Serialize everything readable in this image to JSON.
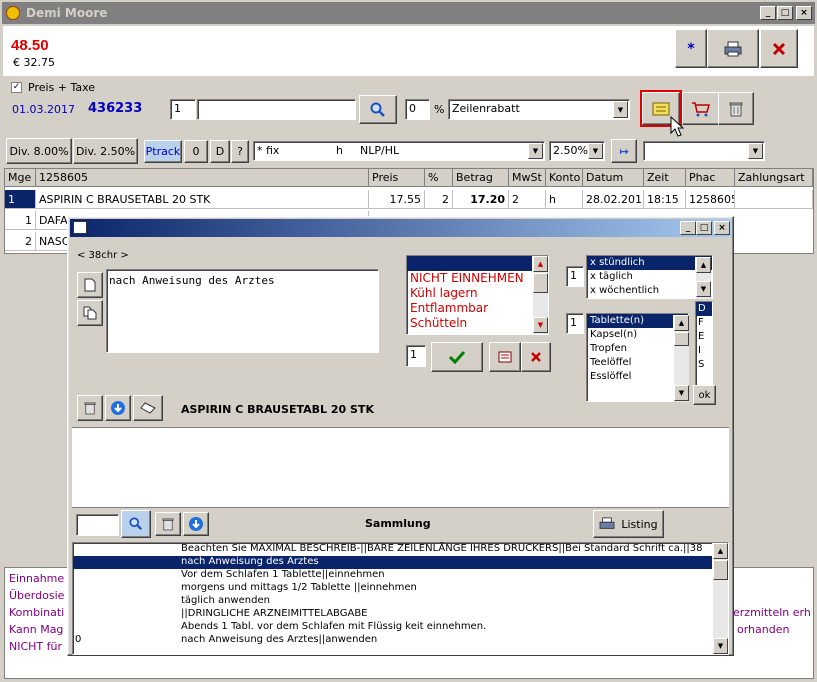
{
  "window": {
    "title": "Demi Moore"
  },
  "header": {
    "price_main": "48.50",
    "price_sub": "€ 32.75",
    "star_label": "*"
  },
  "toolbar": {
    "checkbox_label": "Preis + Taxe",
    "date": "01.03.2017",
    "number": "436233",
    "qty_value": "1",
    "article_value": "",
    "percent_value": "0",
    "percent_sign": "%",
    "discount_select": "Zeilenrabatt"
  },
  "row2": {
    "div1": "Div. 8.00%",
    "div2": "Div. 2.50%",
    "ptrack": "Ptrack",
    "zero": "0",
    "d": "D",
    "q": "?",
    "fix_select": "* fix",
    "fix_h": "h",
    "fix_nlp": "NLP/HL",
    "vat_select": "2.50%",
    "right_select": ""
  },
  "table": {
    "headers": [
      "Mge",
      "1258605",
      "Preis",
      "%",
      "Betrag",
      "MwSt",
      "Konto",
      "Datum",
      "Zeit",
      "Phac",
      "Zahlungsart"
    ],
    "rows": [
      [
        "1",
        "ASPIRIN C BRAUSETABL 20 STK",
        "17.55",
        "2",
        "17.20",
        "2",
        "h",
        "28.02.2017",
        "18:15",
        "1258605",
        ""
      ],
      [
        "1",
        "DAFA",
        "",
        "",
        "",
        "",
        "",
        "",
        "",
        "",
        ""
      ],
      [
        "2",
        "NASC",
        "",
        "",
        "",
        "",
        "",
        "",
        "",
        "",
        ""
      ]
    ]
  },
  "info_lines": [
    "Einnahme",
    "Überdosie",
    "Kombinati",
    "Kann Mag",
    "NICHT für"
  ],
  "info_right": [
    "erzmitteln erh",
    "orhanden"
  ],
  "dialog": {
    "char_count": "< 38chr >",
    "text": "nach Anweisung des Arztes",
    "warnings": [
      "",
      "NICHT EINNEHMEN",
      "Kühl lagern",
      "Entflammbar",
      "Schütteln"
    ],
    "freq_qty": "1",
    "frequency": [
      "x stündlich",
      "x täglich",
      "x wöchentlich"
    ],
    "form_qty": "1",
    "forms": [
      "Tablette(n)",
      "Kapsel(n)",
      "Tropfen",
      "Teelöffel",
      "Esslöffel",
      ""
    ],
    "lang": [
      "D",
      "F",
      "E",
      "I",
      "S"
    ],
    "ok": "ok",
    "warn_qty": "1",
    "product": "ASPIRIN C BRAUSETABL 20 STK",
    "search_value": "",
    "sammlung": "Sammlung",
    "listing": "Listing",
    "collection": [
      {
        "left": "",
        "text": "Beachten Sie MAXIMAL BESCHREIB-||BARE ZEILENLÄNGE IHRES DRUCKERS||Bei Standard Schrift ca.||38"
      },
      {
        "left": "",
        "text": "nach Anweisung des Arztes"
      },
      {
        "left": "",
        "text": "Vor dem Schlafen 1 Tablette||einnehmen"
      },
      {
        "left": "",
        "text": "morgens und mittags 1/2 Tablette ||einnehmen"
      },
      {
        "left": "",
        "text": "täglich anwenden"
      },
      {
        "left": "",
        "text": "||DRINGLICHE ARZNEIMITTELABGABE"
      },
      {
        "left": "",
        "text": "Abends 1 Tabl. vor dem Schlafen mit Flüssig keit einnehmen."
      },
      {
        "left": "0",
        "text": "nach Anweisung des Arztes||anwenden"
      }
    ]
  }
}
